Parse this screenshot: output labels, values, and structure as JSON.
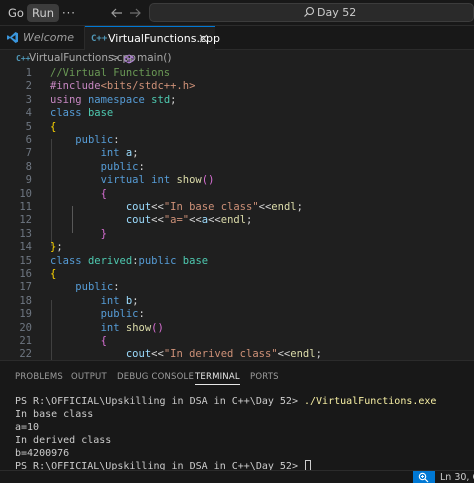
{
  "titlebar": {
    "menus": {
      "go": "Go",
      "run": "Run",
      "more": "···"
    },
    "search_text": "Day 52"
  },
  "tabs": [
    {
      "label": "Welcome",
      "icon": "vscode-icon"
    },
    {
      "label": "VirtualFunctions.cpp",
      "icon": "cpp-file-icon"
    }
  ],
  "breadcrumb": {
    "file": "VirtualFunctions.cpp",
    "separator": ">",
    "symbol": "main()",
    "file_icon": "C++"
  },
  "editor": {
    "lines": [
      {
        "n": "1",
        "t": [
          [
            "cm",
            "//Virtual Functions"
          ]
        ]
      },
      {
        "n": "2",
        "t": [
          [
            "pp",
            "#include"
          ],
          [
            "inc",
            "<bits/stdc++.h>"
          ]
        ]
      },
      {
        "n": "3",
        "t": [
          [
            "pp",
            "using"
          ],
          [
            "pl",
            " "
          ],
          [
            "kw",
            "namespace"
          ],
          [
            "pl",
            " "
          ],
          [
            "ty",
            "std"
          ],
          [
            "pl",
            ";"
          ]
        ]
      },
      {
        "n": "4",
        "t": [
          [
            "kw",
            "class"
          ],
          [
            "pl",
            " "
          ],
          [
            "ty",
            "base"
          ]
        ]
      },
      {
        "n": "5",
        "t": [
          [
            "b1",
            "{"
          ]
        ]
      },
      {
        "n": "6",
        "t": [
          [
            "pl",
            "    "
          ],
          [
            "kw",
            "public"
          ],
          [
            "pl",
            ":"
          ]
        ]
      },
      {
        "n": "7",
        "t": [
          [
            "pl",
            "        "
          ],
          [
            "kw",
            "int"
          ],
          [
            "pl",
            " "
          ],
          [
            "id",
            "a"
          ],
          [
            "pl",
            ";"
          ]
        ]
      },
      {
        "n": "8",
        "t": [
          [
            "pl",
            "        "
          ],
          [
            "kw",
            "public"
          ],
          [
            "pl",
            ":"
          ]
        ]
      },
      {
        "n": "9",
        "t": [
          [
            "pl",
            "        "
          ],
          [
            "kw",
            "virtual"
          ],
          [
            "pl",
            " "
          ],
          [
            "kw",
            "int"
          ],
          [
            "pl",
            " "
          ],
          [
            "fn",
            "show"
          ],
          [
            "b2",
            "()"
          ]
        ]
      },
      {
        "n": "10",
        "t": [
          [
            "pl",
            "        "
          ],
          [
            "b2",
            "{"
          ]
        ]
      },
      {
        "n": "11",
        "t": [
          [
            "pl",
            "            "
          ],
          [
            "id",
            "cout"
          ],
          [
            "pl",
            "<<"
          ],
          [
            "st",
            "\"In base class\""
          ],
          [
            "pl",
            "<<"
          ],
          [
            "fn",
            "endl"
          ],
          [
            "pl",
            ";"
          ]
        ]
      },
      {
        "n": "12",
        "t": [
          [
            "pl",
            "            "
          ],
          [
            "id",
            "cout"
          ],
          [
            "pl",
            "<<"
          ],
          [
            "st",
            "\"a=\""
          ],
          [
            "pl",
            "<<"
          ],
          [
            "id",
            "a"
          ],
          [
            "pl",
            "<<"
          ],
          [
            "fn",
            "endl"
          ],
          [
            "pl",
            ";"
          ]
        ]
      },
      {
        "n": "13",
        "t": [
          [
            "pl",
            "        "
          ],
          [
            "b2",
            "}"
          ]
        ]
      },
      {
        "n": "14",
        "t": [
          [
            "b1",
            "}"
          ],
          [
            "pl",
            ";"
          ]
        ]
      },
      {
        "n": "15",
        "t": [
          [
            "kw",
            "class"
          ],
          [
            "pl",
            " "
          ],
          [
            "ty",
            "derived"
          ],
          [
            "pl",
            ":"
          ],
          [
            "kw",
            "public"
          ],
          [
            "pl",
            " "
          ],
          [
            "ty",
            "base"
          ]
        ]
      },
      {
        "n": "16",
        "t": [
          [
            "b1",
            "{"
          ]
        ]
      },
      {
        "n": "17",
        "t": [
          [
            "pl",
            "    "
          ],
          [
            "kw",
            "public"
          ],
          [
            "pl",
            ":"
          ]
        ]
      },
      {
        "n": "18",
        "t": [
          [
            "pl",
            "        "
          ],
          [
            "kw",
            "int"
          ],
          [
            "pl",
            " "
          ],
          [
            "id",
            "b"
          ],
          [
            "pl",
            ";"
          ]
        ]
      },
      {
        "n": "19",
        "t": [
          [
            "pl",
            "        "
          ],
          [
            "kw",
            "public"
          ],
          [
            "pl",
            ":"
          ]
        ]
      },
      {
        "n": "20",
        "t": [
          [
            "pl",
            "        "
          ],
          [
            "kw",
            "int"
          ],
          [
            "pl",
            " "
          ],
          [
            "fn",
            "show"
          ],
          [
            "b2",
            "()"
          ]
        ]
      },
      {
        "n": "21",
        "t": [
          [
            "pl",
            "        "
          ],
          [
            "b2",
            "{"
          ]
        ]
      },
      {
        "n": "22",
        "t": [
          [
            "pl",
            "            "
          ],
          [
            "id",
            "cout"
          ],
          [
            "pl",
            "<<"
          ],
          [
            "st",
            "\"In derived class\""
          ],
          [
            "pl",
            "<<"
          ],
          [
            "fn",
            "endl"
          ],
          [
            "pl",
            ";"
          ]
        ]
      }
    ]
  },
  "panel": {
    "tabs": [
      "PROBLEMS",
      "OUTPUT",
      "DEBUG CONSOLE",
      "TERMINAL",
      "PORTS"
    ],
    "active_tab": "TERMINAL",
    "terminal": {
      "prompt1": "PS R:\\OFFICIAL\\Upskilling in DSA in C++\\Day 52> ",
      "command1": "./VirtualFunctions.exe",
      "out1": "In base class",
      "out2": "a=10",
      "out3": "In derived class",
      "out4": "b=4200976",
      "prompt2": "PS R:\\OFFICIAL\\Upskilling in DSA in C++\\Day 52> "
    }
  },
  "statusbar": {
    "position": "Ln 30, Col"
  },
  "colors": {
    "accent": "#0078d4",
    "background": "#1f1f1f",
    "chrome": "#181818"
  }
}
